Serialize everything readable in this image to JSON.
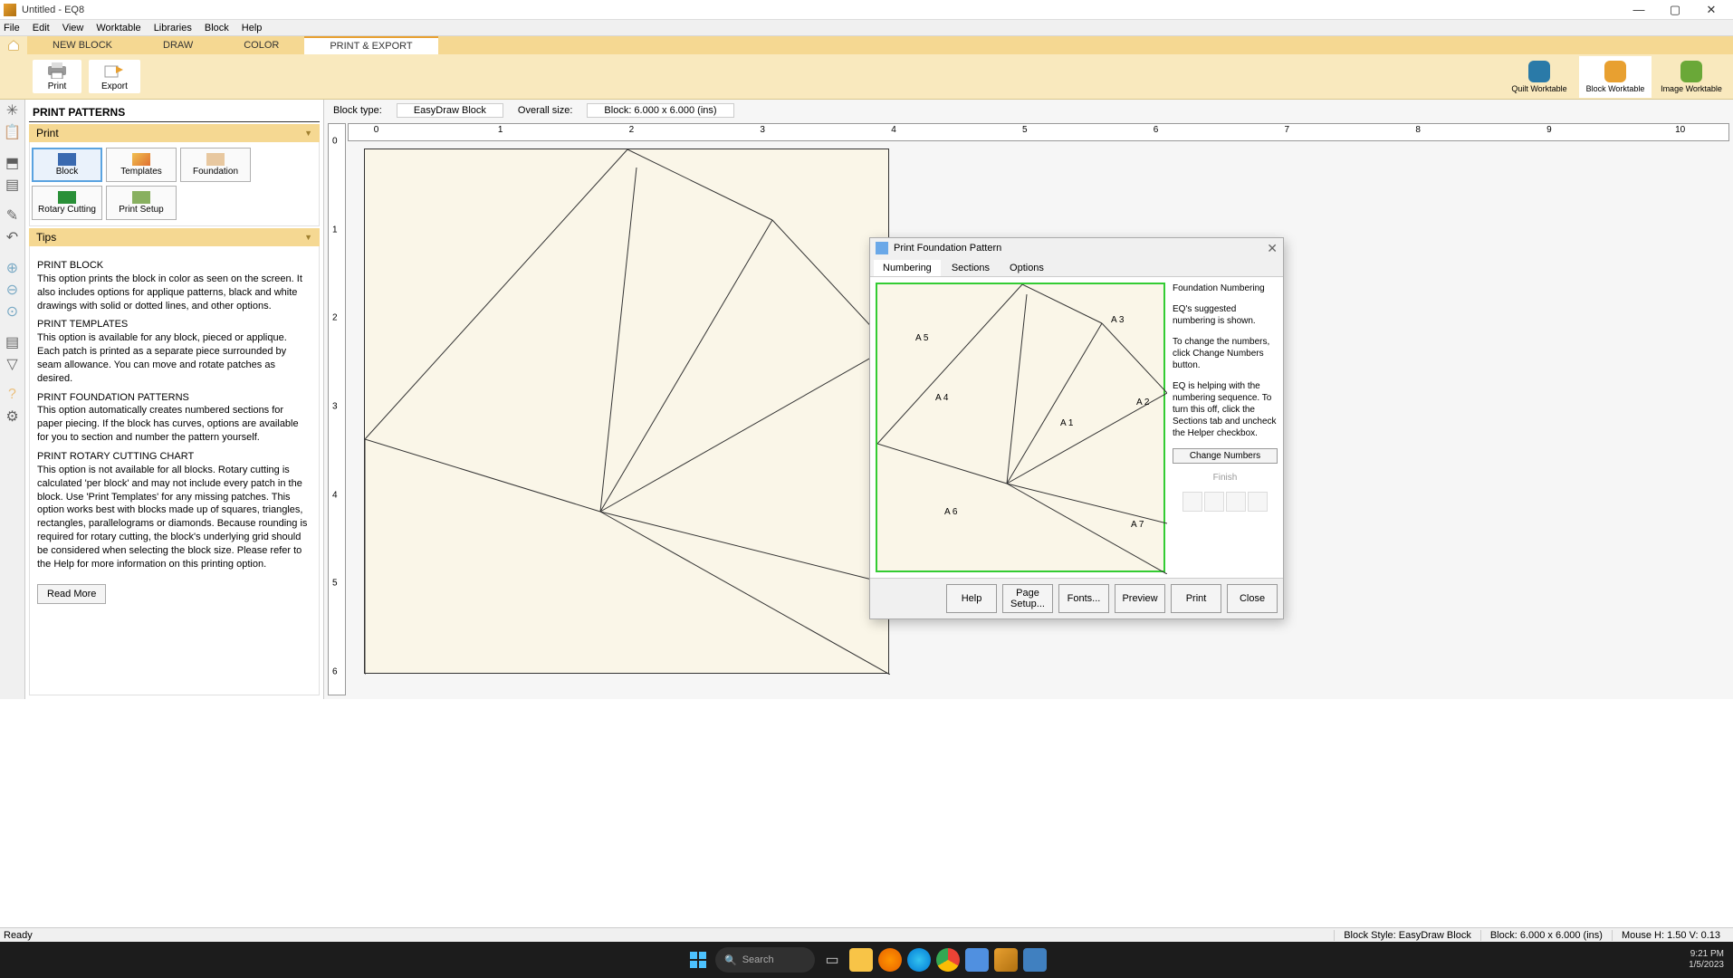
{
  "window": {
    "title": "Untitled - EQ8"
  },
  "menu": [
    "File",
    "Edit",
    "View",
    "Worktable",
    "Libraries",
    "Block",
    "Help"
  ],
  "tabs": {
    "home_aria": "Home",
    "items": [
      "NEW BLOCK",
      "DRAW",
      "COLOR",
      "PRINT & EXPORT"
    ],
    "active": 3
  },
  "ribbon": {
    "print": "Print",
    "export": "Export",
    "worktables": [
      "Quilt Worktable",
      "Block Worktable",
      "Image Worktable"
    ]
  },
  "leftpanel": {
    "header": "PRINT PATTERNS",
    "print_section": "Print",
    "buttons": [
      "Block",
      "Templates",
      "Foundation",
      "Rotary Cutting",
      "Print Setup"
    ],
    "tips_section": "Tips",
    "tips": [
      {
        "h": "PRINT BLOCK",
        "p": "This option prints the block in color as seen on the screen. It also includes options for applique patterns, black and white drawings with solid or dotted lines, and other options."
      },
      {
        "h": "PRINT TEMPLATES",
        "p": "This option is available for any block, pieced or applique. Each patch is printed as a separate piece surrounded by seam allowance. You can move and rotate patches as desired."
      },
      {
        "h": "PRINT FOUNDATION PATTERNS",
        "p": "This option automatically creates numbered sections for paper piecing. If the block has curves, options are available for you to section and number the pattern yourself."
      },
      {
        "h": "PRINT ROTARY CUTTING CHART",
        "p": "This option is not available for all blocks. Rotary cutting is calculated 'per block' and may not include every patch in the block. Use 'Print Templates' for any missing patches. This option works best with blocks made up of squares, triangles, rectangles, parallelograms or diamonds. Because rounding is required for rotary cutting, the block's underlying grid should be considered when selecting the block size. Please refer to the Help for more information on this printing option."
      }
    ],
    "read_more": "Read More"
  },
  "canvas": {
    "block_type_label": "Block type:",
    "block_type": "EasyDraw Block",
    "overall_size_label": "Overall size:",
    "overall_size": "Block: 6.000 x 6.000 (ins)",
    "ruler_h": [
      "0",
      "1",
      "2",
      "3",
      "4",
      "5",
      "6",
      "7",
      "8",
      "9",
      "10"
    ],
    "ruler_v": [
      "0",
      "1",
      "2",
      "3",
      "4",
      "5",
      "6"
    ]
  },
  "dialog": {
    "title": "Print Foundation Pattern",
    "tabs": [
      "Numbering",
      "Sections",
      "Options"
    ],
    "active_tab": 0,
    "segments": [
      "A 1",
      "A 2",
      "A 3",
      "A 4",
      "A 5",
      "A 6",
      "A 7"
    ],
    "side": {
      "heading": "Foundation Numbering",
      "text1": "EQ's suggested numbering is shown.",
      "text2": "To change the numbers, click Change Numbers button.",
      "text3": "EQ is helping with the numbering sequence. To turn this off, click the Sections tab and uncheck the Helper checkbox.",
      "change_btn": "Change Numbers",
      "finish": "Finish"
    },
    "footer": [
      "Help",
      "Page Setup...",
      "Fonts...",
      "Preview",
      "Print",
      "Close"
    ]
  },
  "status": {
    "ready": "Ready",
    "style": "Block Style: EasyDraw Block",
    "size": "Block: 6.000 x 6.000 (ins)",
    "mouse": "Mouse   H:  1.50     V:  0.13"
  },
  "taskbar": {
    "search": "Search",
    "time": "9:21 PM",
    "date": "1/5/2023"
  }
}
